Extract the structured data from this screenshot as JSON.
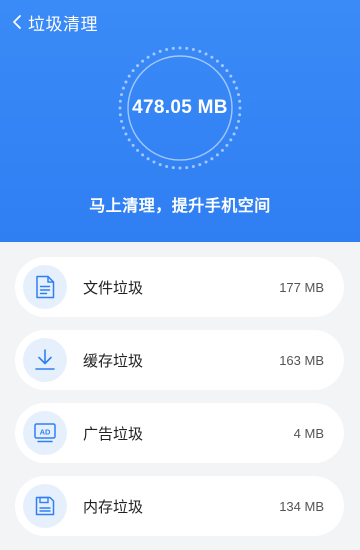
{
  "header": {
    "title": "垃圾清理",
    "total_size": "478.05 MB",
    "tagline": "马上清理，提升手机空间"
  },
  "items": [
    {
      "label": "文件垃圾",
      "size": "177 MB",
      "icon": "document-icon"
    },
    {
      "label": "缓存垃圾",
      "size": "163 MB",
      "icon": "download-icon"
    },
    {
      "label": "广告垃圾",
      "size": "4 MB",
      "icon": "ad-icon"
    },
    {
      "label": "内存垃圾",
      "size": "134 MB",
      "icon": "memory-icon"
    }
  ],
  "colors": {
    "header_blue": "#3a8af7",
    "icon_blue": "#2f7ff3",
    "icon_bg": "#e6f0fc",
    "page_bg": "#f3f4f6"
  }
}
